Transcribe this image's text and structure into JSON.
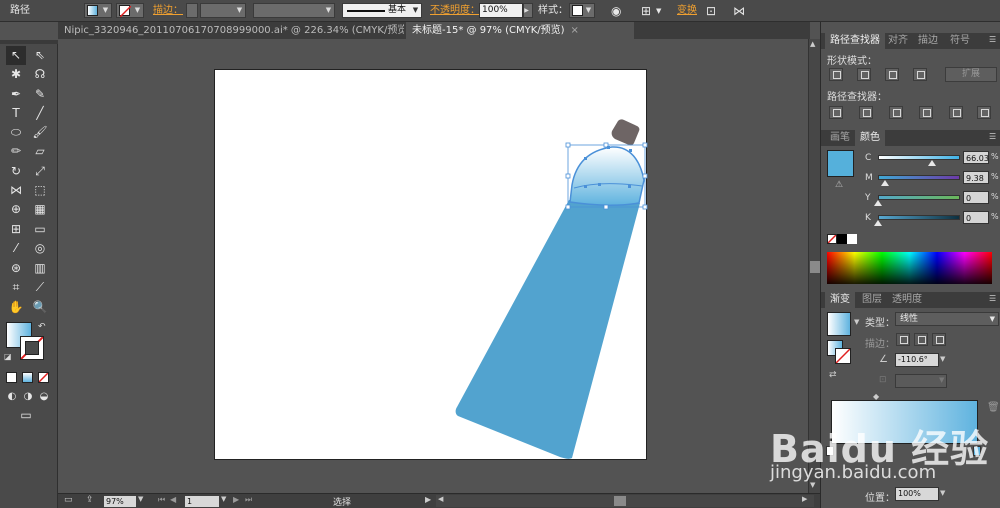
{
  "control_bar": {
    "object_type": "路径",
    "stroke_label": "描边：",
    "stroke_style": "基本",
    "opacity_label": "不透明度：",
    "opacity_value": "100%",
    "style_label": "样式：",
    "transform_label": "变换"
  },
  "tabs": [
    {
      "label": "Nipic_3320946_20110706170708999000.ai* @ 226.34% (CMYK/预览)",
      "active": false
    },
    {
      "label": "未标题-15* @ 97% (CMYK/预览)",
      "active": true
    }
  ],
  "status_bar": {
    "zoom": "97%",
    "page": "1",
    "tool_name": "选择"
  },
  "pathfinder": {
    "tabs": [
      "路径查找器",
      "对齐",
      "描边",
      "符号"
    ],
    "shape_modes_label": "形状模式：",
    "expand_label": "扩展",
    "pathfinders_label": "路径查找器："
  },
  "color_panel": {
    "tabs": [
      "画笔",
      "颜色"
    ],
    "channels": [
      {
        "label": "C",
        "value": "66.03",
        "level": 0.66,
        "track": "linear-gradient(to right,#ffffff,#3fb2e6)"
      },
      {
        "label": "M",
        "value": "9.38",
        "level": 0.09,
        "track": "linear-gradient(to right,#40a8d4,#6c3aa8)"
      },
      {
        "label": "Y",
        "value": "0",
        "level": 0.0,
        "track": "linear-gradient(to right,#54a8c8,#6ab75a)"
      },
      {
        "label": "K",
        "value": "0",
        "level": 0.0,
        "track": "linear-gradient(to right,#58a8d0,#0d3040)"
      }
    ],
    "percent_sign": "%",
    "current_color": "#55b0db"
  },
  "gradient_panel": {
    "tabs": [
      "渐变",
      "图层",
      "透明度"
    ],
    "type_label": "类型：",
    "type_value": "线性",
    "stroke_label": "描边：",
    "angle_value": "-110.6°",
    "location_label": "位置：",
    "location_value": "100%",
    "gradient_start": "#ffffff",
    "gradient_end": "#5fb3df"
  },
  "watermark": {
    "brand": "Baidu 经验",
    "url": "jingyan.baidu.com"
  },
  "colors": {
    "shape_blue": "#52a3cf",
    "cap_gray": "#6e6565",
    "selection": "#4a90d8"
  }
}
